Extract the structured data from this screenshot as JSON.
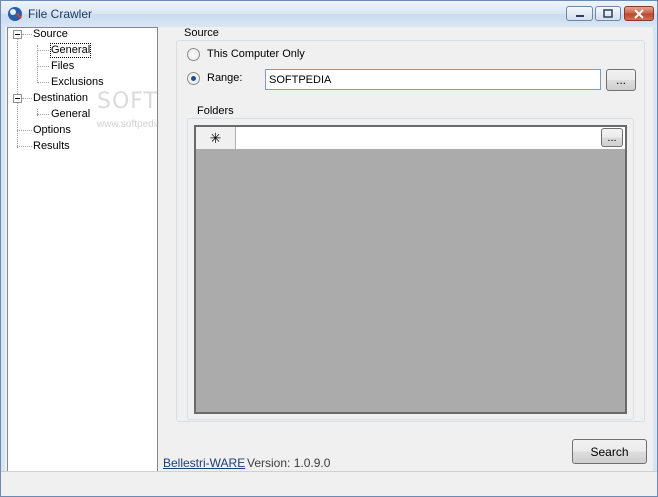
{
  "window": {
    "title": "File Crawler"
  },
  "tree": {
    "items": [
      {
        "label": "Source"
      },
      {
        "label": "General"
      },
      {
        "label": "Files"
      },
      {
        "label": "Exclusions"
      },
      {
        "label": "Destination"
      },
      {
        "label": "General"
      },
      {
        "label": "Options"
      },
      {
        "label": "Results"
      }
    ]
  },
  "source": {
    "group_label": "Source",
    "option_this_computer": "This Computer Only",
    "option_range": "Range:",
    "range_value": "SOFTPEDIA",
    "browse_label": "..."
  },
  "folders": {
    "group_label": "Folders",
    "new_row_marker": "✳",
    "browse_label": "..."
  },
  "footer": {
    "brand": "Bellestri-WARE",
    "version": "Version: 1.0.9.0",
    "search_label": "Search"
  },
  "watermark": {
    "text": "SOFTPEDIA",
    "url": "www.softpedia.com"
  }
}
